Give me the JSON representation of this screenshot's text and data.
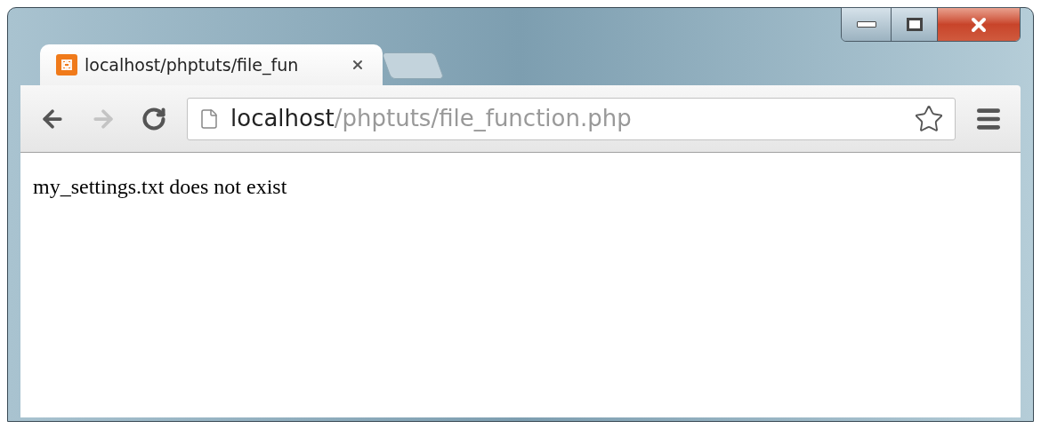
{
  "tabs": [
    {
      "title": "localhost/phptuts/file_fun",
      "selected": true
    }
  ],
  "toolbar": {
    "back": {
      "disabled": false
    },
    "forward": {
      "disabled": true
    }
  },
  "address_bar": {
    "host": "localhost",
    "path": "/phptuts/file_function.php"
  },
  "page": {
    "text": "my_settings.txt does not exist"
  }
}
